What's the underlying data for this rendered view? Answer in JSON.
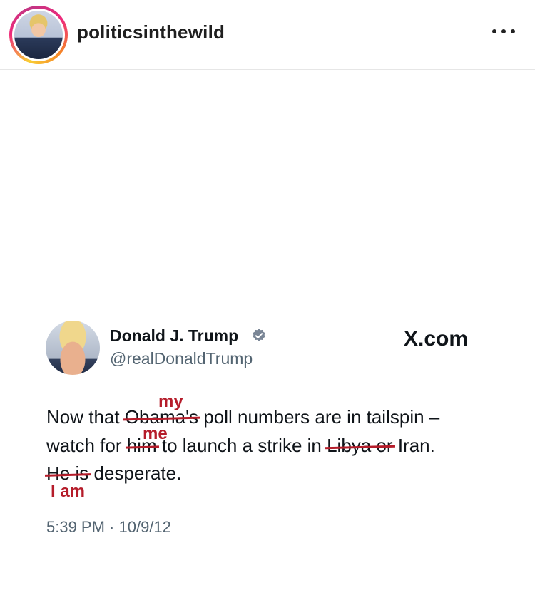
{
  "header": {
    "username": "politicsinthewild",
    "more_icon": "ellipsis-icon",
    "ring_colors": [
      "#f9ce34",
      "#ee2a7b",
      "#c13584",
      "#f58529"
    ]
  },
  "tweet": {
    "display_name": "Donald J. Trump",
    "handle": "@realDonaldTrump",
    "verified_icon": "verified-badge-icon",
    "verified_color": "#7a8696",
    "site_label": "X.com",
    "line1_before": "Now that ",
    "line1_struck": "Obama's",
    "line1_after": " poll numbers are in tailspin –",
    "line2_before": "watch for ",
    "line2_struck": "him",
    "line2_middle": " to launch a strike in ",
    "line2_struck2": "Libya or",
    "line2_after": " Iran.",
    "line3_struck": "He is",
    "line3_after": " desperate.",
    "edit_my": "my",
    "edit_me": "me",
    "edit_i_am": "I am",
    "edit_color": "#b51c2a",
    "timestamp": "5:39 PM · 10/9/12"
  }
}
